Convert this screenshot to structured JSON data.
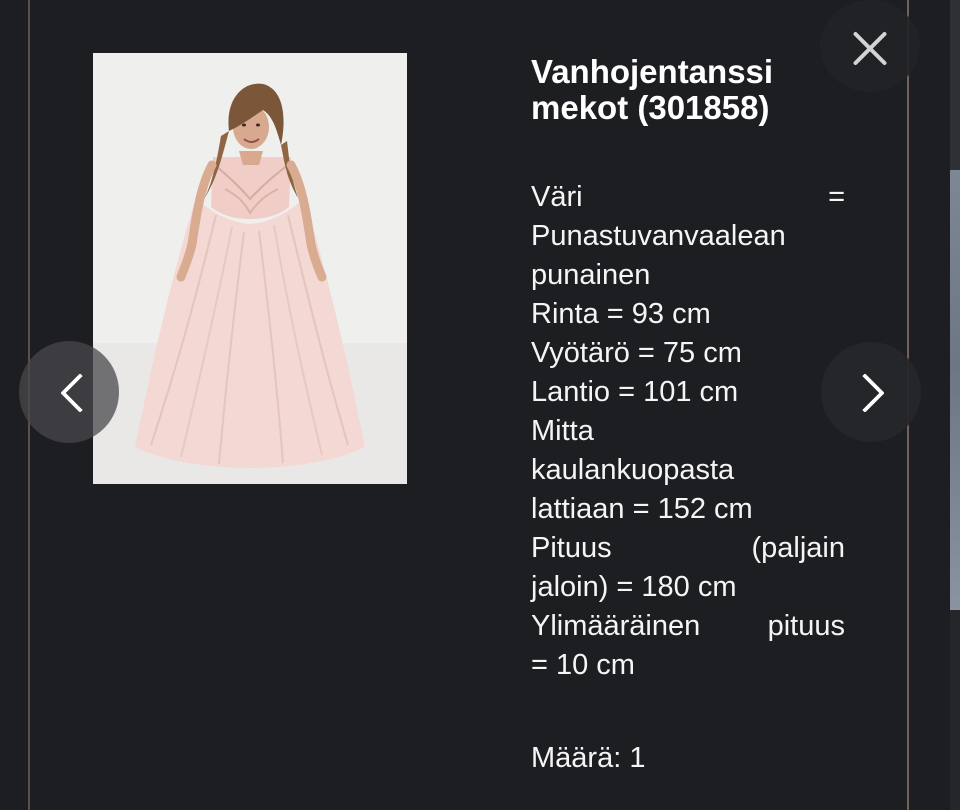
{
  "product": {
    "title_line_1": "Vanhojentanssi",
    "title_line_2": "mekot (301858)",
    "image_alt": "Punastuvanvaalean punaisen tanssiaismekon kuva"
  },
  "details": {
    "color_label": "Väri",
    "equals": "=",
    "color_value_1": "Punastuvanvaalean",
    "color_value_2": "punainen",
    "bust": "Rinta = 93 cm",
    "waist": "Vyötärö = 75 cm",
    "hips": "Lantio = 101 cm",
    "measure_line_1": "Mitta",
    "measure_line_2": "kaulankuopasta",
    "measure_line_3": "lattiaan = 152 cm",
    "height_line_1_left": "Pituus",
    "height_line_1_right": "(paljain",
    "height_line_2": "jaloin) = 180 cm",
    "extra_line_1_left": "Ylimääräinen",
    "extra_line_1_right": "pituus",
    "extra_line_2": "= 10 cm"
  },
  "quantity": {
    "text": "Määrä: 1"
  },
  "icons": {
    "close": "close-icon",
    "previous": "chevron-left-icon",
    "next": "chevron-right-icon"
  },
  "colors": {
    "background": "#1d1e22",
    "text": "#f5f5f5",
    "frame_line": "#8c6f68"
  }
}
